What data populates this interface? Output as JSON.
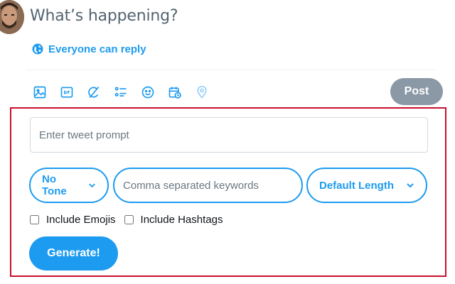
{
  "compose": {
    "placeholder": "What’s happening?"
  },
  "reply_setting": {
    "label": "Everyone can reply"
  },
  "toolbar": {
    "icons": [
      "image-icon",
      "gif-icon",
      "grok-icon",
      "poll-icon",
      "emoji-icon",
      "schedule-icon",
      "location-icon"
    ],
    "post_label": "Post"
  },
  "extension": {
    "prompt_placeholder": "Enter tweet prompt",
    "tone_selected": "No Tone",
    "keywords_placeholder": "Comma separated keywords",
    "length_selected": "Default Length",
    "include_emojis_label": "Include Emojis",
    "include_hashtags_label": "Include Hashtags",
    "generate_label": "Generate!"
  },
  "colors": {
    "accent": "#1d9bf0",
    "post_disabled": "#8b98a5",
    "panel_border": "#c8102e"
  }
}
